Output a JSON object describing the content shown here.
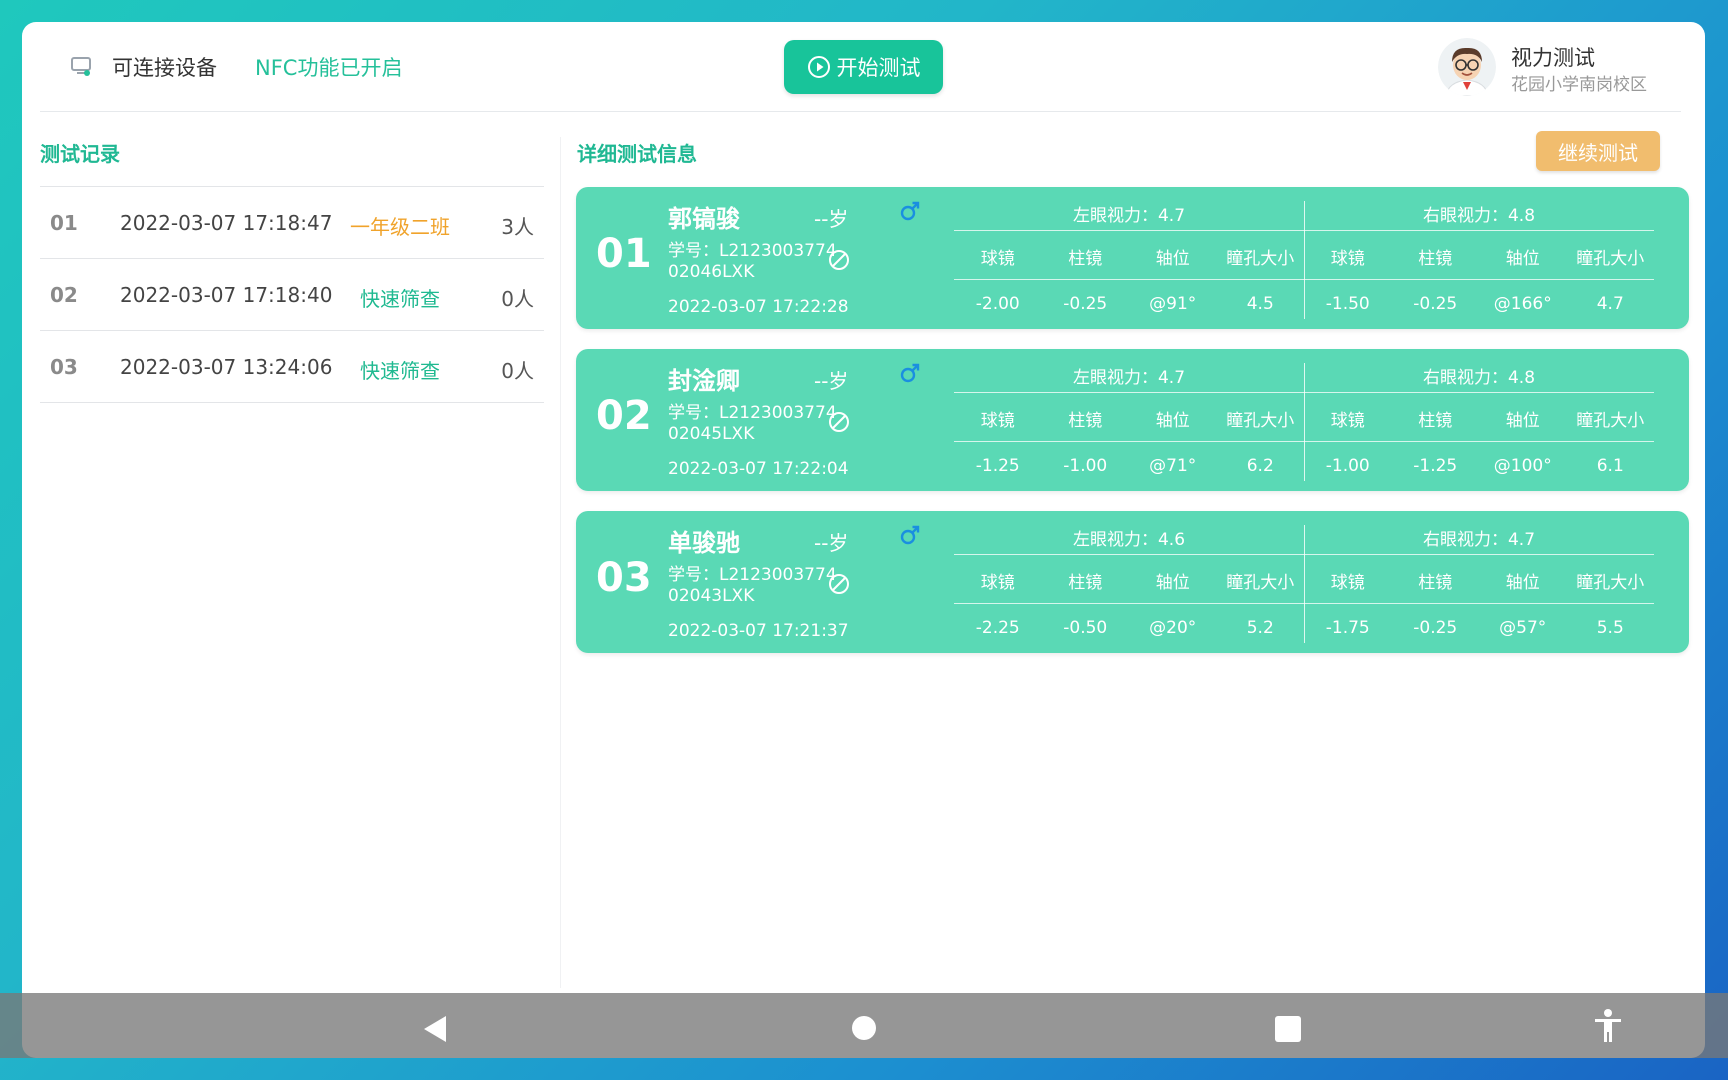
{
  "header": {
    "device_label": "可连接设备",
    "nfc_status": "NFC功能已开启",
    "start_button": "开始测试",
    "app_title": "视力测试",
    "school": "花园小学南岗校区"
  },
  "left_panel": {
    "title": "测试记录",
    "records": [
      {
        "no": "01",
        "time": "2022-03-07 17:18:47",
        "type": "一年级二班",
        "type_color": "#f0a32b",
        "count": "3人"
      },
      {
        "no": "02",
        "time": "2022-03-07 17:18:40",
        "type": "快速筛查",
        "type_color": "#1fb990",
        "count": "0人"
      },
      {
        "no": "03",
        "time": "2022-03-07 13:24:06",
        "type": "快速筛查",
        "type_color": "#1fb990",
        "count": "0人"
      }
    ]
  },
  "right_panel": {
    "title": "详细测试信息",
    "continue_button": "继续测试",
    "columns": [
      "球镜",
      "柱镜",
      "轴位",
      "瞳孔大小"
    ],
    "students": [
      {
        "index": "01",
        "name": "郭镐骏",
        "age": "--岁",
        "gender_icon": "male-icon",
        "id_line1": "学号：L2123003774",
        "id_line2": "02046LXK",
        "time": "2022-03-07 17:22:28",
        "left_eye": {
          "title": "左眼视力：4.7",
          "values": [
            "-2.00",
            "-0.25",
            "@91°",
            "4.5"
          ]
        },
        "right_eye": {
          "title": "右眼视力：4.8",
          "values": [
            "-1.50",
            "-0.25",
            "@166°",
            "4.7"
          ]
        }
      },
      {
        "index": "02",
        "name": "封淦卿",
        "age": "--岁",
        "gender_icon": "male-icon",
        "id_line1": "学号：L2123003774",
        "id_line2": "02045LXK",
        "time": "2022-03-07 17:22:04",
        "left_eye": {
          "title": "左眼视力：4.7",
          "values": [
            "-1.25",
            "-1.00",
            "@71°",
            "6.2"
          ]
        },
        "right_eye": {
          "title": "右眼视力：4.8",
          "values": [
            "-1.00",
            "-1.25",
            "@100°",
            "6.1"
          ]
        }
      },
      {
        "index": "03",
        "name": "单骏驰",
        "age": "--岁",
        "gender_icon": "male-icon",
        "id_line1": "学号：L2123003774",
        "id_line2": "02043LXK",
        "time": "2022-03-07 17:21:37",
        "left_eye": {
          "title": "左眼视力：4.6",
          "values": [
            "-2.25",
            "-0.50",
            "@20°",
            "5.2"
          ]
        },
        "right_eye": {
          "title": "右眼视力：4.7",
          "values": [
            "-1.75",
            "-0.25",
            "@57°",
            "5.5"
          ]
        }
      }
    ]
  },
  "navbar": {
    "icons": [
      "back-icon",
      "home-icon",
      "recent-apps-icon",
      "accessibility-icon"
    ]
  },
  "colors": {
    "accent": "#18c49a",
    "card": "#5ad9b5",
    "continue": "#f1bd6e",
    "gender": "#1a8fe0"
  }
}
